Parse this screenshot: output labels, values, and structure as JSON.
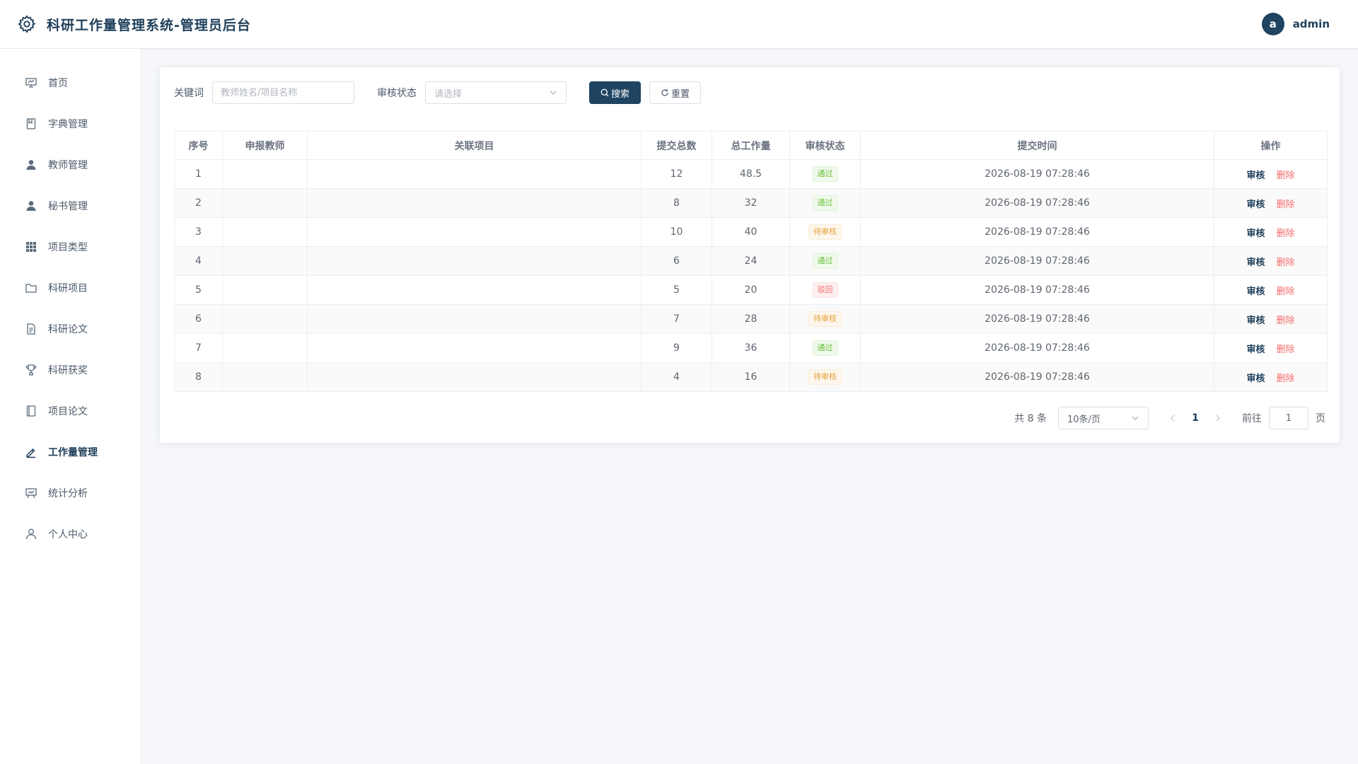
{
  "header": {
    "title": "科研工作量管理系统-管理员后台",
    "avatar_letter": "a",
    "username": "admin"
  },
  "sidebar": {
    "items": [
      {
        "label": "首页",
        "icon": "home-board-icon"
      },
      {
        "label": "字典管理",
        "icon": "book-icon"
      },
      {
        "label": "教师管理",
        "icon": "user-filled-icon"
      },
      {
        "label": "秘书管理",
        "icon": "user-filled-icon"
      },
      {
        "label": "项目类型",
        "icon": "grid-icon"
      },
      {
        "label": "科研项目",
        "icon": "folder-icon"
      },
      {
        "label": "科研论文",
        "icon": "document-icon"
      },
      {
        "label": "科研获奖",
        "icon": "trophy-icon"
      },
      {
        "label": "项目论文",
        "icon": "notebook-icon"
      },
      {
        "label": "工作量管理",
        "icon": "edit-pen-icon",
        "active": true
      },
      {
        "label": "统计分析",
        "icon": "presentation-icon"
      },
      {
        "label": "个人中心",
        "icon": "user-outline-icon"
      }
    ]
  },
  "filters": {
    "keyword_label": "关键词",
    "keyword_placeholder": "教师姓名/项目名称",
    "status_label": "审核状态",
    "status_placeholder": "请选择",
    "search_label": "搜索",
    "reset_label": "重置"
  },
  "table": {
    "columns": [
      "序号",
      "申报教师",
      "关联项目",
      "提交总数",
      "总工作量",
      "审核状态",
      "提交时间",
      "操作"
    ],
    "review_label": "审核",
    "delete_label": "删除",
    "rows": [
      {
        "index": "1",
        "teacher": "",
        "project": "",
        "count": "12",
        "workload": "48.5",
        "status": "通过",
        "status_type": "success",
        "time": "2026-08-19 07:28:46"
      },
      {
        "index": "2",
        "teacher": "",
        "project": "",
        "count": "8",
        "workload": "32",
        "status": "通过",
        "status_type": "success",
        "time": "2026-08-19 07:28:46"
      },
      {
        "index": "3",
        "teacher": "",
        "project": "",
        "count": "10",
        "workload": "40",
        "status": "待审核",
        "status_type": "warning",
        "time": "2026-08-19 07:28:46"
      },
      {
        "index": "4",
        "teacher": "",
        "project": "",
        "count": "6",
        "workload": "24",
        "status": "通过",
        "status_type": "success",
        "time": "2026-08-19 07:28:46"
      },
      {
        "index": "5",
        "teacher": "",
        "project": "",
        "count": "5",
        "workload": "20",
        "status": "驳回",
        "status_type": "danger",
        "time": "2026-08-19 07:28:46"
      },
      {
        "index": "6",
        "teacher": "",
        "project": "",
        "count": "7",
        "workload": "28",
        "status": "待审核",
        "status_type": "warning",
        "time": "2026-08-19 07:28:46"
      },
      {
        "index": "7",
        "teacher": "",
        "project": "",
        "count": "9",
        "workload": "36",
        "status": "通过",
        "status_type": "success",
        "time": "2026-08-19 07:28:46"
      },
      {
        "index": "8",
        "teacher": "",
        "project": "",
        "count": "4",
        "workload": "16",
        "status": "待审核",
        "status_type": "warning",
        "time": "2026-08-19 07:28:46"
      }
    ]
  },
  "pagination": {
    "total_text": "共 8 条",
    "page_size": "10条/页",
    "current_page": "1",
    "goto_label": "前往",
    "goto_value": "1",
    "page_suffix": "页"
  },
  "colors": {
    "primary": "#1e4461",
    "success": "#67c23a",
    "warning": "#e6a23c",
    "danger": "#f56c6c"
  }
}
